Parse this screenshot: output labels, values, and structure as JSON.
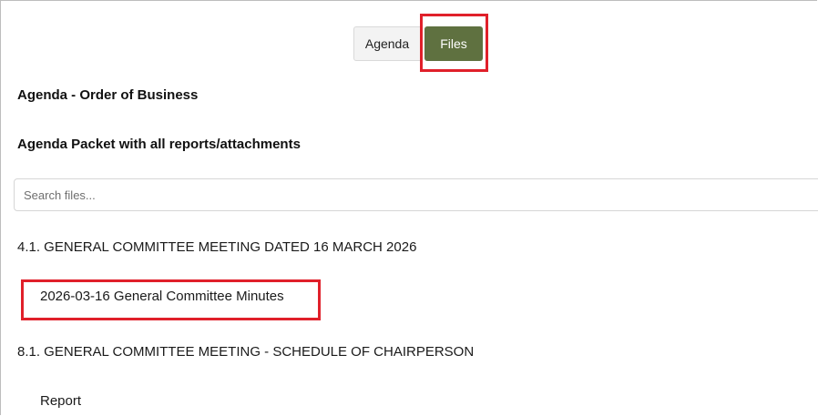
{
  "tabs": {
    "agenda_label": "Agenda",
    "files_label": "Files"
  },
  "headings": {
    "order_of_business": "Agenda - Order of Business",
    "agenda_packet": "Agenda Packet with all reports/attachments"
  },
  "search": {
    "placeholder": "Search files..."
  },
  "sections": [
    {
      "title": "4.1. GENERAL COMMITTEE MEETING DATED 16 MARCH 2026",
      "files": [
        "2026-03-16 General Committee Minutes"
      ]
    },
    {
      "title": "8.1. GENERAL COMMITTEE MEETING - SCHEDULE OF CHAIRPERSON",
      "files": [
        "Report"
      ]
    }
  ],
  "colors": {
    "files_tab_active": "#5f7140",
    "highlight": "#e0202a"
  }
}
